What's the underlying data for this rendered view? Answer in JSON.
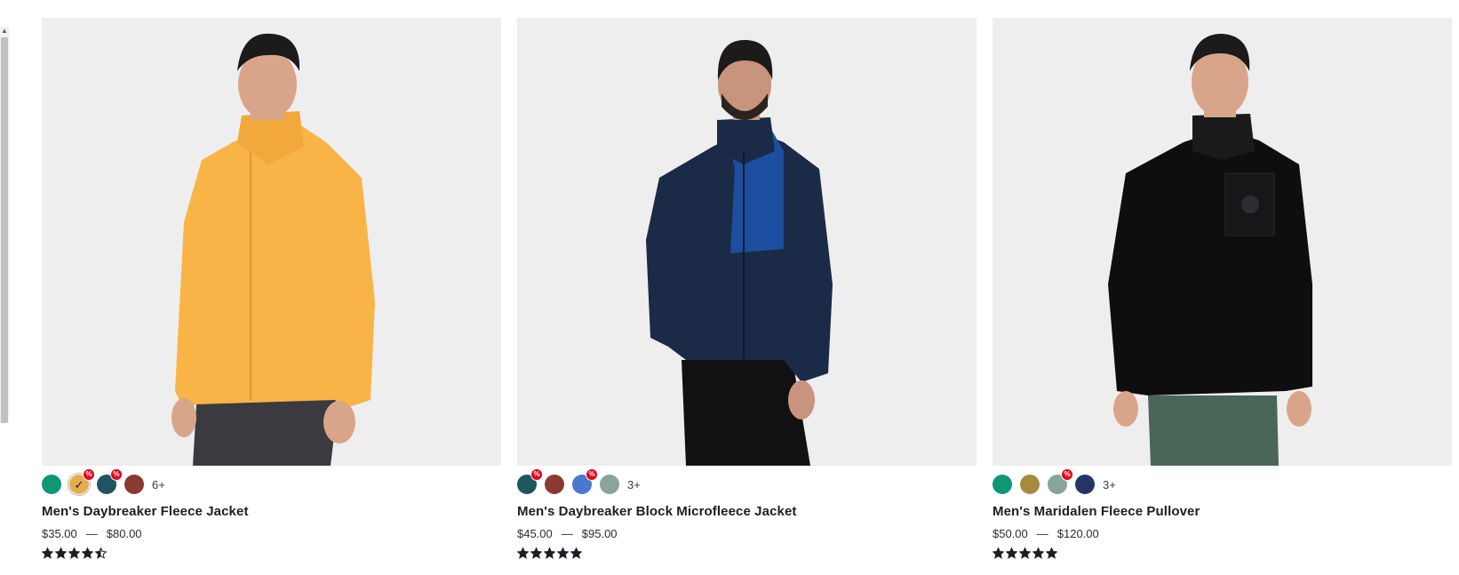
{
  "products": [
    {
      "name": "Men's Daybreaker Fleece Jacket",
      "price_from": "$35.00",
      "price_separator": "—",
      "price_to": "$80.00",
      "more_colors": "6+",
      "rating": 4.5,
      "jacket_color": "#f8b446",
      "pants_color": "#3a3a40",
      "swatches": [
        {
          "color": "#0f9673",
          "sale": false,
          "selected": false
        },
        {
          "color": "#e3ad4c",
          "sale": true,
          "selected": true
        },
        {
          "color": "#1f5560",
          "sale": true,
          "selected": false
        },
        {
          "color": "#8a3a30",
          "sale": false,
          "selected": false
        }
      ]
    },
    {
      "name": "Men's Daybreaker Block Microfleece Jacket",
      "price_from": "$45.00",
      "price_separator": "—",
      "price_to": "$95.00",
      "more_colors": "3+",
      "rating": 5,
      "jacket_color": "#1b2a47",
      "accent_color": "#1d4fa0",
      "pants_color": "#111114",
      "swatches": [
        {
          "color": "#1f5560",
          "sale": true,
          "selected": false
        },
        {
          "color": "#8a3a30",
          "sale": false,
          "selected": false
        },
        {
          "color": "#4a78cf",
          "sale": true,
          "selected": false
        },
        {
          "color": "#8aa39d",
          "sale": false,
          "selected": false
        }
      ]
    },
    {
      "name": "Men's Maridalen Fleece Pullover",
      "price_from": "$50.00",
      "price_separator": "—",
      "price_to": "$120.00",
      "more_colors": "3+",
      "rating": 5,
      "jacket_color": "#0e0e10",
      "pants_color": "#4a6658",
      "swatches": [
        {
          "color": "#0f9673",
          "sale": false,
          "selected": false
        },
        {
          "color": "#a88a3e",
          "sale": false,
          "selected": false
        },
        {
          "color": "#8aa39d",
          "sale": true,
          "selected": false
        },
        {
          "color": "#253566",
          "sale": false,
          "selected": false
        }
      ]
    }
  ],
  "sale_badge": "%",
  "selected_mark": "✓"
}
